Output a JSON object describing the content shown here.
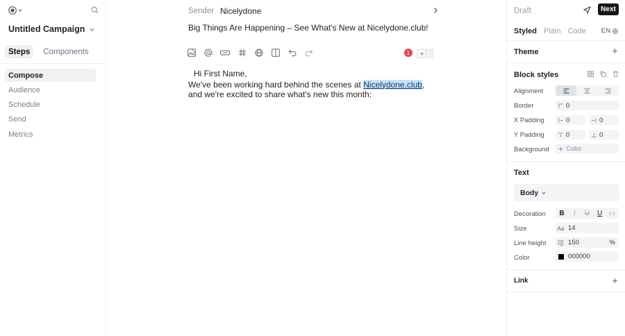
{
  "sidebar": {
    "campaign_name": "Untitled Campaign",
    "tabs": [
      {
        "label": "Steps"
      },
      {
        "label": "Components"
      }
    ],
    "steps": [
      {
        "label": "Compose"
      },
      {
        "label": "Audience"
      },
      {
        "label": "Schedule"
      },
      {
        "label": "Send"
      },
      {
        "label": "Metrics"
      }
    ]
  },
  "editor": {
    "sender_label": "Sender",
    "sender_value": "Nicelydone",
    "subject": "Big Things Are Happening – See What's New at Nicelydone.club!",
    "variable_count": "1",
    "greeting": "Hi First Name,",
    "body_pre": "We've been working hard behind the scenes at ",
    "body_link": "Nicelydone.club",
    "body_post": ", and we're excited to share what's new this month:"
  },
  "panel": {
    "status": "Draft",
    "next_label": "Next",
    "modes": [
      {
        "label": "Styled"
      },
      {
        "label": "Plain"
      },
      {
        "label": "Code"
      }
    ],
    "language": "EN",
    "theme_title": "Theme",
    "block_styles_title": "Block styles",
    "alignment_label": "Alignment",
    "border_label": "Border",
    "border_value": "0",
    "x_padding_label": "X Padding",
    "x_padding_left": "0",
    "x_padding_right": "0",
    "y_padding_label": "Y Padding",
    "y_padding_top": "0",
    "y_padding_bottom": "0",
    "background_label": "Background",
    "background_placeholder": "Color",
    "text_title": "Text",
    "text_style": "Body",
    "decoration_label": "Decoration",
    "size_label": "Size",
    "size_value": "14",
    "line_height_label": "Line height",
    "line_height_value": "150",
    "line_height_unit": "%",
    "color_label": "Color",
    "color_value": "000000",
    "link_title": "Link"
  },
  "colors": {
    "accent": "#151719",
    "selection": "#c9e2fb",
    "badge": "#e5484d",
    "swatch": "#000000"
  }
}
